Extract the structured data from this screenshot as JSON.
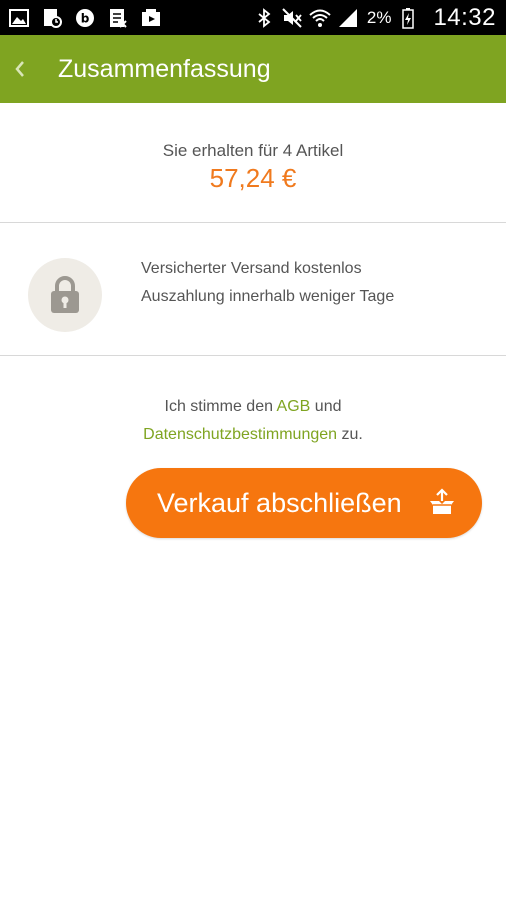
{
  "status_bar": {
    "left_icons": [
      "gallery-notification-icon",
      "clipboard-notification-icon",
      "beats-audio-icon",
      "document-notification-icon",
      "media-notification-icon"
    ],
    "right_icons": [
      "bluetooth-icon",
      "mute-icon",
      "wifi-icon",
      "signal-icon",
      "battery-icon"
    ],
    "battery_text": "2%",
    "time": "14:32"
  },
  "action_bar": {
    "title": "Zusammenfassung",
    "background": "#7fa421"
  },
  "summary": {
    "text": "Sie erhalten für 4 Artikel",
    "amount": "57,24 €",
    "amount_color": "#f07a1e"
  },
  "info": {
    "icon": "lock-icon",
    "line1": "Versicherter Versand kostenlos",
    "line2": "Auszahlung innerhalb weniger Tage"
  },
  "consent": {
    "prefix": "Ich stimme den ",
    "agb_link": "AGB",
    "middle": " und",
    "privacy_link": "Datenschutzbestimmungen",
    "suffix": " zu.",
    "link_color": "#7fa421"
  },
  "cta": {
    "label": "Verkauf abschließen",
    "icon": "box-upload-icon",
    "color": "#f6760f"
  }
}
